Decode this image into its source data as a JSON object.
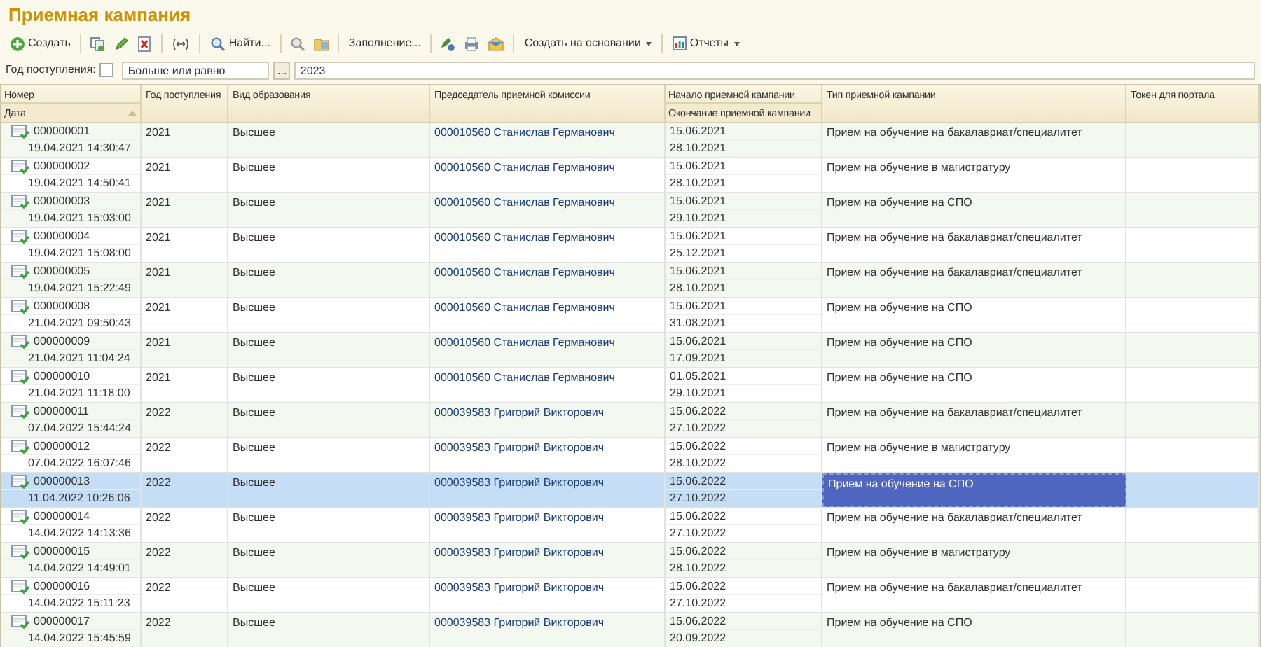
{
  "title": "Приемная кампания",
  "toolbar": [
    {
      "label": "Создать",
      "dropdown": false
    },
    {
      "label": "Найти...",
      "dropdown": false
    },
    {
      "label": "Заполнение...",
      "dropdown": false
    },
    {
      "label": "Создать на основании",
      "dropdown": true
    },
    {
      "label": "Отчеты",
      "dropdown": true
    }
  ],
  "filter": {
    "label": "Год поступления:",
    "checked": false,
    "comparison": "Больше или равно",
    "choose_button": "...",
    "value": "2023"
  },
  "table": {
    "columns": [
      {
        "top": "Номер",
        "bottom": "Дата"
      },
      {
        "top": "Год поступления"
      },
      {
        "top": "Вид образования"
      },
      {
        "top": "Председатель приемной комиссии"
      },
      {
        "top": "Начало приемной кампании",
        "bottom": "Окончание приемной кампании"
      },
      {
        "top": "Тип приемной кампании"
      },
      {
        "top": "Токен для портала"
      }
    ],
    "rows": [
      {
        "number": "000000001",
        "date": "19.04.2021 14:30:47",
        "year": "2021",
        "education": "Высшее",
        "chair": "000010560 Станислав Германович",
        "start": "15.06.2021",
        "end": "28.10.2021",
        "type": "Прием на обучение на бакалавриат/специалитет",
        "selected": false
      },
      {
        "number": "000000002",
        "date": "19.04.2021 14:50:41",
        "year": "2021",
        "education": "Высшее",
        "chair": "000010560 Станислав Германович",
        "start": "15.06.2021",
        "end": "28.10.2021",
        "type": "Прием на обучение в магистратуру",
        "selected": false
      },
      {
        "number": "000000003",
        "date": "19.04.2021 15:03:00",
        "year": "2021",
        "education": "Высшее",
        "chair": "000010560 Станислав Германович",
        "start": "15.06.2021",
        "end": "29.10.2021",
        "type": "Прием на обучение на СПО",
        "selected": false
      },
      {
        "number": "000000004",
        "date": "19.04.2021 15:08:00",
        "year": "2021",
        "education": "Высшее",
        "chair": "000010560 Станислав Германович",
        "start": "15.06.2021",
        "end": "25.12.2021",
        "type": "Прием на обучение на бакалавриат/специалитет",
        "selected": false
      },
      {
        "number": "000000005",
        "date": "19.04.2021 15:22:49",
        "year": "2021",
        "education": "Высшее",
        "chair": "000010560 Станислав Германович",
        "start": "15.06.2021",
        "end": "28.10.2021",
        "type": "Прием на обучение на бакалавриат/специалитет",
        "selected": false
      },
      {
        "number": "000000008",
        "date": "21.04.2021 09:50:43",
        "year": "2021",
        "education": "Высшее",
        "chair": "000010560 Станислав Германович",
        "start": "15.06.2021",
        "end": "31.08.2021",
        "type": "Прием на обучение на СПО",
        "selected": false
      },
      {
        "number": "000000009",
        "date": "21.04.2021 11:04:24",
        "year": "2021",
        "education": "Высшее",
        "chair": "000010560 Станислав Германович",
        "start": "15.06.2021",
        "end": "17.09.2021",
        "type": "Прием на обучение на СПО",
        "selected": false
      },
      {
        "number": "000000010",
        "date": "21.04.2021 11:18:00",
        "year": "2021",
        "education": "Высшее",
        "chair": "000010560 Станислав Германович",
        "start": "01.05.2021",
        "end": "29.10.2021",
        "type": "Прием на обучение на СПО",
        "selected": false
      },
      {
        "number": "000000011",
        "date": "07.04.2022 15:44:24",
        "year": "2022",
        "education": "Высшее",
        "chair": "000039583 Григорий Викторович",
        "start": "15.06.2022",
        "end": "27.10.2022",
        "type": "Прием на обучение на бакалавриат/специалитет",
        "selected": false
      },
      {
        "number": "000000012",
        "date": "07.04.2022 16:07:46",
        "year": "2022",
        "education": "Высшее",
        "chair": "000039583 Григорий Викторович",
        "start": "15.06.2022",
        "end": "28.10.2022",
        "type": "Прием на обучение в магистратуру",
        "selected": false
      },
      {
        "number": "000000013",
        "date": "11.04.2022 10:26:06",
        "year": "2022",
        "education": "Высшее",
        "chair": "000039583 Григорий Викторович",
        "start": "15.06.2022",
        "end": "27.10.2022",
        "type": "Прием на обучение на СПО",
        "selected": true
      },
      {
        "number": "000000014",
        "date": "14.04.2022 14:13:36",
        "year": "2022",
        "education": "Высшее",
        "chair": "000039583 Григорий Викторович",
        "start": "15.06.2022",
        "end": "27.10.2022",
        "type": "Прием на обучение на бакалавриат/специалитет",
        "selected": false
      },
      {
        "number": "000000015",
        "date": "14.04.2022 14:49:01",
        "year": "2022",
        "education": "Высшее",
        "chair": "000039583 Григорий Викторович",
        "start": "15.06.2022",
        "end": "28.10.2022",
        "type": "Прием на обучение в магистратуру",
        "selected": false
      },
      {
        "number": "000000016",
        "date": "14.04.2022 15:11:23",
        "year": "2022",
        "education": "Высшее",
        "chair": "000039583 Григорий Викторович",
        "start": "15.06.2022",
        "end": "27.10.2022",
        "type": "Прием на обучение на бакалавриат/специалитет",
        "selected": false
      },
      {
        "number": "000000017",
        "date": "14.04.2022 15:45:59",
        "year": "2022",
        "education": "Высшее",
        "chair": "000039583 Григорий Викторович",
        "start": "15.06.2022",
        "end": "20.09.2022",
        "type": "Прием на обучение на СПО",
        "selected": false
      }
    ]
  }
}
